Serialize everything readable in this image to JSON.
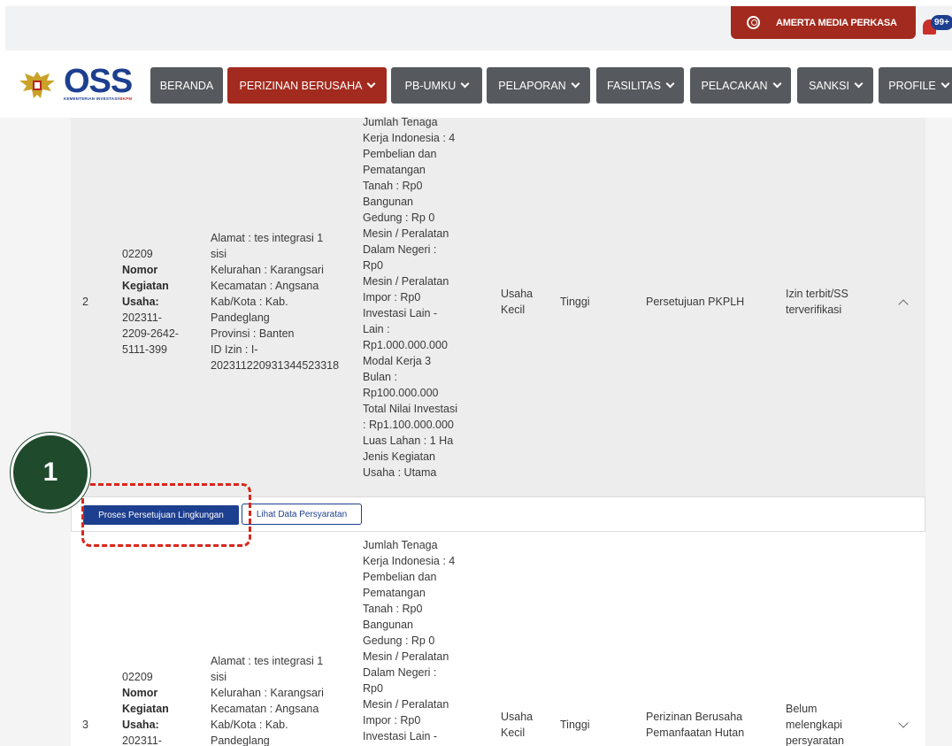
{
  "header": {
    "user_name": "AMERTA MEDIA PERKASA",
    "notification_count": "99+"
  },
  "logo": {
    "title": "OSS",
    "subtitle_main": "KEMENTERIAN INVESTASI/",
    "subtitle_accent": "BKPM"
  },
  "nav": {
    "beranda": "BERANDA",
    "perizinan": "PERIZINAN BERUSAHA",
    "pbumku": "PB-UMKU",
    "pelaporan": "PELAPORAN",
    "fasilitas": "FASILITAS",
    "pelacakan": "PELACAKAN",
    "sanksi": "SANKSI",
    "profile": "PROFILE"
  },
  "rows": [
    {
      "no": "2",
      "kode": [
        "02209"
      ],
      "kegiatan_label": [
        "Nomor",
        "Kegiatan",
        "Usaha:"
      ],
      "kegiatan_no": [
        "202311-",
        "2209-2642-",
        "5111-399"
      ],
      "alamat": [
        "Alamat : tes integrasi 1",
        "sisi",
        "Kelurahan : Karangsari",
        "Kecamatan : Angsana",
        "Kab/Kota : Kab.",
        "Pandeglang",
        "Provinsi : Banten",
        "ID Izin : I-",
        "202311220931344523318"
      ],
      "investasi": [
        "Jumlah Tenaga",
        "Kerja Indonesia : 4",
        "Pembelian dan",
        "Pematangan",
        "Tanah : Rp0",
        "Bangunan",
        "Gedung : Rp 0",
        "Mesin / Peralatan",
        "Dalam Negeri :",
        "Rp0",
        "Mesin / Peralatan",
        "Impor : Rp0",
        "Investasi Lain -",
        "Lain :",
        "Rp1.000.000.000",
        "Modal Kerja 3",
        "Bulan :",
        "Rp100.000.000",
        "Total Nilai Investasi",
        ": Rp1.100.000.000",
        "Luas Lahan : 1 Ha",
        "Jenis Kegiatan",
        "Usaha : Utama"
      ],
      "skala": [
        "Usaha",
        "Kecil"
      ],
      "risiko": [
        "Tinggi"
      ],
      "perizinan": [
        "Persetujuan PKPLH"
      ],
      "status": [
        "Izin terbit/SS",
        "terverifikasi"
      ]
    },
    {
      "no": "3",
      "kode": [
        "02209"
      ],
      "kegiatan_label": [
        "Nomor",
        "Kegiatan",
        "Usaha:"
      ],
      "kegiatan_no": [
        "202311-"
      ],
      "alamat": [
        "Alamat : tes integrasi 1",
        "sisi",
        "Kelurahan : Karangsari",
        "Kecamatan : Angsana",
        "Kab/Kota : Kab.",
        "Pandeglang"
      ],
      "investasi": [
        "Jumlah Tenaga",
        "Kerja Indonesia : 4",
        "Pembelian dan",
        "Pematangan",
        "Tanah : Rp0",
        "Bangunan",
        "Gedung : Rp 0",
        "Mesin / Peralatan",
        "Dalam Negeri :",
        "Rp0",
        "Mesin / Peralatan",
        "Impor : Rp0",
        "Investasi Lain -"
      ],
      "skala": [
        "Usaha",
        "Kecil"
      ],
      "risiko": [
        "Tinggi"
      ],
      "perizinan": [
        "Perizinan Berusaha",
        "Pemanfaatan Hutan"
      ],
      "status": [
        "Belum",
        "melengkapi",
        "persyaratan"
      ]
    }
  ],
  "actions": {
    "proses": "Proses Persetujuan Lingkungan",
    "lihat": "Lihat Data Persyaratan"
  },
  "marker": {
    "label": "1"
  }
}
